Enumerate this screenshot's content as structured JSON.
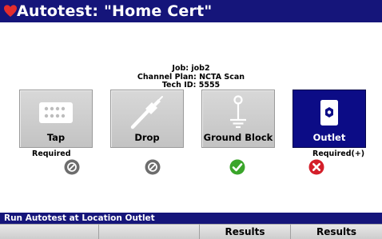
{
  "window": {
    "title": "Autotest: \"Home Cert\"",
    "title_icon": "heart-icon"
  },
  "job_info": {
    "job": "Job: job2",
    "channel_plan": "Channel Plan: NCTA Scan",
    "tech_id": "Tech ID: 5555"
  },
  "locations": [
    {
      "label": "Tap",
      "icon": "tap-icon",
      "requirement": "Required",
      "status": "not-tested",
      "selected": false
    },
    {
      "label": "Drop",
      "icon": "drop-cable-icon",
      "requirement": "",
      "status": "not-tested",
      "selected": false
    },
    {
      "label": "Ground Block",
      "icon": "ground-block-icon",
      "requirement": "",
      "status": "pass",
      "selected": false
    },
    {
      "label": "Outlet",
      "icon": "outlet-icon",
      "requirement": "Required(+)",
      "status": "fail",
      "selected": true
    }
  ],
  "status_bar": {
    "message": "Run Autotest at Location Outlet"
  },
  "softkeys": [
    "",
    "",
    "Results",
    "Results"
  ],
  "colors": {
    "titlebar": "#15157a",
    "selected_button": "#0c0c86",
    "button": "#c8c8c8",
    "pass": "#3aa52a",
    "fail": "#d41f2a",
    "not_tested": "#6d6d6d",
    "title_icon": "#e52d2d"
  }
}
